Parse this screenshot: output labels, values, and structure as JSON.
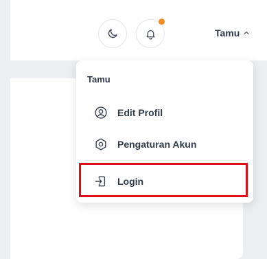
{
  "header": {
    "user_name": "Tamu",
    "icons": {
      "theme": "moon-icon",
      "notifications": "bell-icon",
      "toggle": "chevron-up-icon"
    },
    "notification_dot_color": "#f58a1f"
  },
  "dropdown": {
    "title": "Tamu",
    "items": [
      {
        "label": "Edit Profil",
        "icon": "user-circle-icon"
      },
      {
        "label": "Pengaturan Akun",
        "icon": "gear-icon"
      },
      {
        "label": "Login",
        "icon": "login-icon"
      }
    ]
  },
  "highlight_color": "#e0101a"
}
